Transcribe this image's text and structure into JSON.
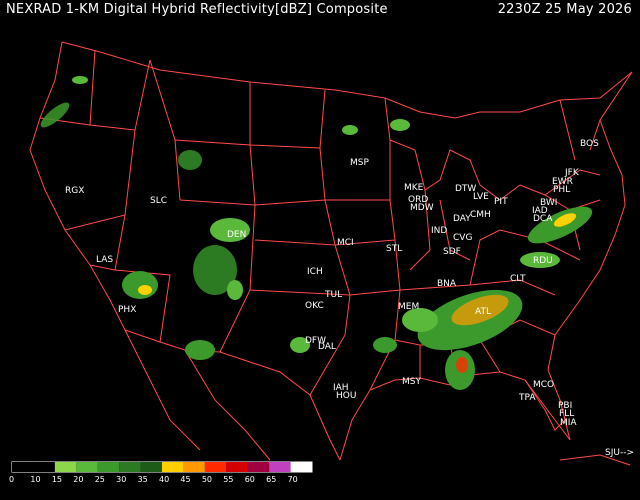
{
  "header": {
    "title": "NEXRAD 1-KM Digital Hybrid Reflectivity[dBZ] Composite",
    "timestamp": "2230Z 25 May 2026"
  },
  "nav": {
    "next_label": "SJU-->"
  },
  "cities": [
    {
      "code": "BOS"
    },
    {
      "code": "JFK"
    },
    {
      "code": "EWR"
    },
    {
      "code": "PHL"
    },
    {
      "code": "BWI"
    },
    {
      "code": "IAD"
    },
    {
      "code": "DCA"
    },
    {
      "code": "PIT"
    },
    {
      "code": "LVE"
    },
    {
      "code": "DTW"
    },
    {
      "code": "CMH"
    },
    {
      "code": "DAY"
    },
    {
      "code": "CVG"
    },
    {
      "code": "SDF"
    },
    {
      "code": "IND"
    },
    {
      "code": "ORD"
    },
    {
      "code": "MDW"
    },
    {
      "code": "MKE"
    },
    {
      "code": "MSP"
    },
    {
      "code": "STL"
    },
    {
      "code": "MCI"
    },
    {
      "code": "ICH"
    },
    {
      "code": "TUL"
    },
    {
      "code": "OKC"
    },
    {
      "code": "DFW"
    },
    {
      "code": "DAL"
    },
    {
      "code": "IAH"
    },
    {
      "code": "HOU"
    },
    {
      "code": "MSY"
    },
    {
      "code": "MEM"
    },
    {
      "code": "BNA"
    },
    {
      "code": "ATL"
    },
    {
      "code": "CLT"
    },
    {
      "code": "RDU"
    },
    {
      "code": "MCO"
    },
    {
      "code": "TPA"
    },
    {
      "code": "PBI"
    },
    {
      "code": "FLL"
    },
    {
      "code": "MIA"
    },
    {
      "code": "DEN"
    },
    {
      "code": "SLC"
    },
    {
      "code": "LAS"
    },
    {
      "code": "PHX"
    },
    {
      "code": "RGX"
    }
  ],
  "color_scale": {
    "labels": [
      "0",
      "10",
      "15",
      "20",
      "25",
      "30",
      "35",
      "40",
      "45",
      "50",
      "55",
      "60",
      "65",
      "70"
    ],
    "colors": [
      "#000000",
      "#000000",
      "#8cd64a",
      "#5ab83a",
      "#3c9a2c",
      "#2c7a22",
      "#1c5c18",
      "#ffd000",
      "#ff9a00",
      "#ff2a00",
      "#d40000",
      "#a00040",
      "#c040c0",
      "#ffffff"
    ]
  },
  "colors": {
    "background": "#000000",
    "border": "#ff4a4a",
    "text": "#ffffff"
  }
}
